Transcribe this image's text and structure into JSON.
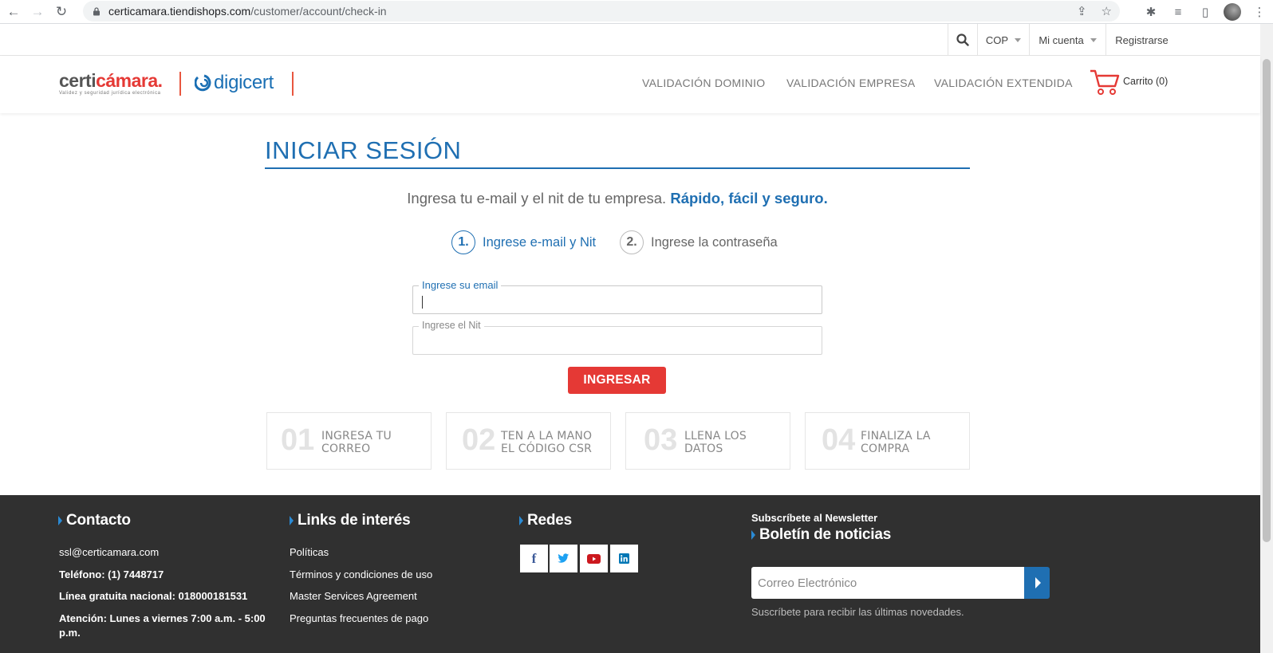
{
  "browser": {
    "url_host": "certicamara.tiendishops.com",
    "url_path": "/customer/account/check-in"
  },
  "topbar": {
    "currency": "COP",
    "account": "Mi cuenta",
    "register": "Registrarse"
  },
  "header": {
    "logo_certi_prefix": "certi",
    "logo_certi_suffix": "cámara.",
    "logo_certi_tagline": "Validez y seguridad jurídica electrónica",
    "logo_digicert": "digicert",
    "nav": [
      "VALIDACIÓN DOMINIO",
      "VALIDACIÓN EMPRESA",
      "VALIDACIÓN EXTENDIDA"
    ],
    "cart_label": "Carrito (0)"
  },
  "login": {
    "title": "INICIAR SESIÓN",
    "subtitle_plain": "Ingresa tu e-mail y el nit de tu empresa.",
    "subtitle_strong": "Rápido, fácil y seguro.",
    "steps": [
      {
        "num": "1.",
        "label": "Ingrese e-mail y Nit"
      },
      {
        "num": "2.",
        "label": "Ingrese la contraseña"
      }
    ],
    "email_label": "Ingrese su email",
    "email_value": "",
    "nit_label": "Ingrese el Nit",
    "nit_value": "",
    "submit": "INGRESAR"
  },
  "process_cards": [
    {
      "num": "01",
      "line1": "INGRESA TU",
      "line2": "CORREO"
    },
    {
      "num": "02",
      "line1": "TEN A LA MANO",
      "line2": "EL CÓDIGO CSR"
    },
    {
      "num": "03",
      "line1": "LLENA LOS",
      "line2": "DATOS"
    },
    {
      "num": "04",
      "line1": "FINALIZA LA",
      "line2": "COMPRA"
    }
  ],
  "footer": {
    "contact_title": "Contacto",
    "contact_email": "ssl@certicamara.com",
    "contact_phone": "Teléfono: (1) 7448717",
    "contact_toll_free": "Línea gratuita nacional: 018000181531",
    "contact_hours_1": "Atención: Lunes a viernes 7:00 a.m. - 5:00",
    "contact_hours_2": "p.m.",
    "links_title": "Links de interés",
    "links": [
      "Políticas",
      "Términos y condiciones de uso",
      "Master Services Agreement",
      "Preguntas frecuentes de pago"
    ],
    "social_title": "Redes",
    "social": [
      {
        "icon": "facebook-icon",
        "glyph": "f",
        "color": "#3b5998"
      },
      {
        "icon": "twitter-icon",
        "glyph": "🐦",
        "color": "#1da1f2"
      },
      {
        "icon": "youtube-icon",
        "glyph": "▶",
        "color": "#cc181e"
      },
      {
        "icon": "linkedin-icon",
        "glyph": "in",
        "color": "#0077b5"
      }
    ],
    "newsletter_kicker": "Subscríbete al Newsletter",
    "newsletter_title": "Boletín de noticias",
    "newsletter_placeholder": "Correo Electrónico",
    "newsletter_help": "Suscríbete para recibir las últimas novedades."
  },
  "colors": {
    "brand_blue": "#1f6fb2",
    "brand_red": "#e53935",
    "footer_bg": "#303030"
  }
}
